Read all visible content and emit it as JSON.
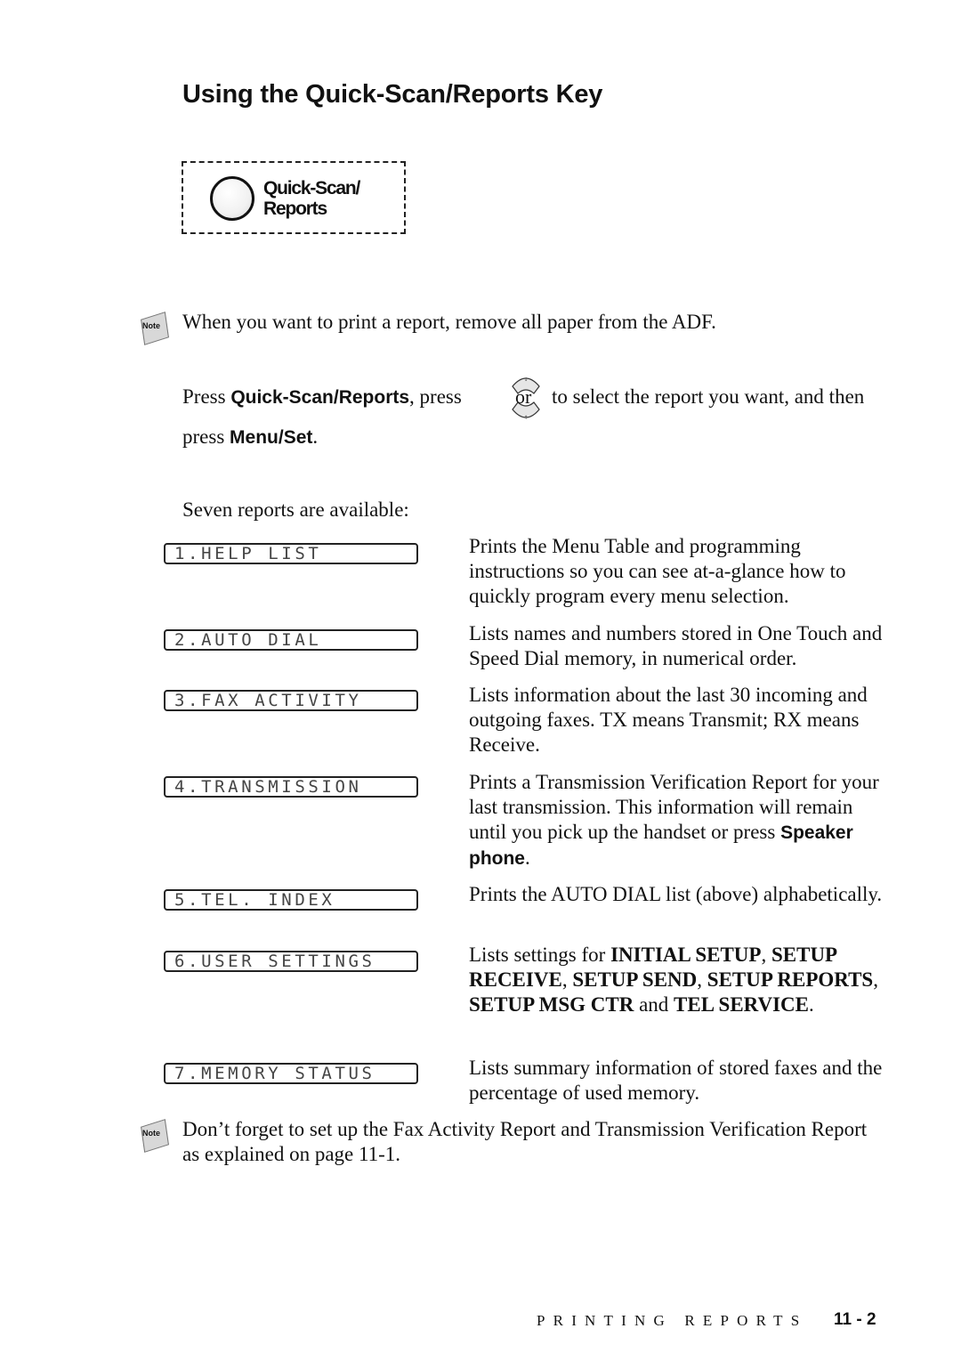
{
  "page": {
    "title": "Using the Quick-Scan/Reports Key",
    "key_illustration": {
      "label_line1": "Quick-Scan/",
      "label_line2": "Reports"
    },
    "note1": {
      "icon_label": "Note",
      "text": "When you want to print a report, remove all paper from the ADF."
    },
    "instruction": {
      "p1": "Press ",
      "key1": "Quick-Scan/Reports",
      "p2": ", press ",
      "arrow_or": "or",
      "p3": " to select the report you want, and then",
      "p4": "press ",
      "key2": "Menu/Set",
      "p5": "."
    },
    "intro": "Seven reports are available:",
    "reports": [
      {
        "lcd": "1.HELP LIST",
        "description": "Prints the Menu Table and programming instructions so you can see at-a-glance how to quickly program every menu selection."
      },
      {
        "lcd": "2.AUTO DIAL",
        "description": "Lists names and numbers stored in One Touch and Speed Dial memory, in numerical order."
      },
      {
        "lcd": "3.FAX ACTIVITY",
        "description": "Lists information about the last 30 incoming and outgoing faxes. TX means Transmit; RX means Receive."
      },
      {
        "lcd": "4.TRANSMISSION",
        "description": "Prints a Transmission Verification Report for your last transmission. This information will remain until you pick up the handset or press",
        "key": "Speaker phone",
        "tail": "."
      },
      {
        "lcd": "5.TEL. INDEX",
        "description": "Prints the AUTO DIAL list (above) alphabetically."
      },
      {
        "lcd": "6.USER SETTINGS",
        "d1": "Lists settings for ",
        "b1": "INITIAL SETUP",
        "s1": ", ",
        "b2": "SETUP RECEIVE",
        "s2": ", ",
        "b3": "SETUP SEND",
        "s3": ", ",
        "b4": "SETUP REPORTS",
        "s4": ", ",
        "b5": "SETUP MSG CTR",
        "s5": " and ",
        "b6": "TEL SERVICE",
        "s6": "."
      },
      {
        "lcd": "7.MEMORY STATUS",
        "description": "Lists summary information of stored faxes and the percentage of used memory."
      }
    ],
    "note2": {
      "icon_label": "Note",
      "text": "Don’t forget to set up the Fax Activity Report and Transmission Verification Report as explained on page 11-1."
    },
    "footer": {
      "section": "PRINTING REPORTS",
      "page_number": "11 - 2"
    }
  }
}
